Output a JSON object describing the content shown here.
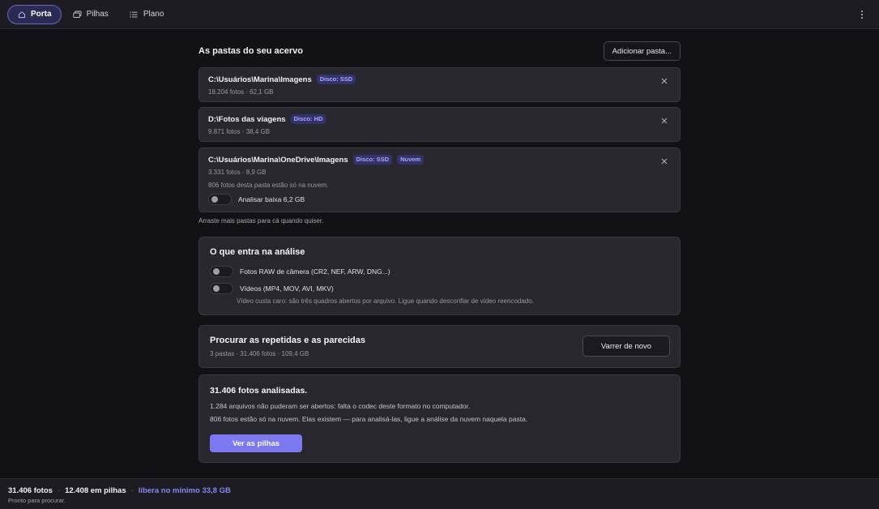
{
  "topbar": {
    "nav": [
      {
        "label": "Porta",
        "icon": "home-icon",
        "active": true
      },
      {
        "label": "Pilhas",
        "icon": "photos-stack-icon",
        "active": false
      },
      {
        "label": "Plano",
        "icon": "list-icon",
        "active": false
      }
    ],
    "menu_icon": "more-vertical-icon"
  },
  "folders_section": {
    "title": "As pastas do seu acervo",
    "add_button": "Adicionar pasta...",
    "folders": [
      {
        "path": "C:\\Usuários\\Marina\\Imagens",
        "badges": [
          "Disco: SSD"
        ],
        "meta": "18.204 fotos · 62,1 GB"
      },
      {
        "path": "D:\\Fotos das viagens",
        "badges": [
          "Disco: HD"
        ],
        "meta": "9.871 fotos · 38,4 GB"
      },
      {
        "path": "C:\\Usuários\\Marina\\OneDrive\\Imagens",
        "badges": [
          "Disco: SSD",
          "Nuvem"
        ],
        "meta": "3.331 fotos · 8,9 GB",
        "note": "806 fotos desta pasta estão só na nuvem.",
        "toggle_label": "Analisar baixa 6,2 GB",
        "toggle_on": false
      }
    ],
    "hint": "Arraste mais pastas para cá quando quiser."
  },
  "analysis": {
    "title": "O que entra na análise",
    "options": [
      {
        "label": "Fotos RAW de câmera (CR2, NEF, ARW, DNG...)",
        "on": false
      },
      {
        "label": "Vídeos (MP4, MOV, AVI, MKV)",
        "on": false
      }
    ],
    "video_note": "Vídeo custa caro: são três quadros abertos por arquivo. Ligue quando desconfiar de vídeo reencodado."
  },
  "search": {
    "title": "Procurar as repetidas e as parecidas",
    "summary": "3 pastas · 31.406 fotos · 109,4 GB",
    "button": "Varrer de novo"
  },
  "result": {
    "title": "31.406 fotos analisadas.",
    "line1": "1.284 arquivos não puderam ser abertos: falta o codec deste formato no computador.",
    "line2": "806 fotos estão só na nuvem. Elas existem — para analisá-las, ligue a análise da nuvem naquela pasta.",
    "button": "Ver as pilhas"
  },
  "statusbar": {
    "photos": "31.406 fotos",
    "stacks": "12.408 em pilhas",
    "frees": "libera no mínimo 33,8 GB",
    "status": "Pronto para procurar."
  },
  "colors": {
    "background": "#121116",
    "card": "#28272d",
    "accent": "#7c79f0",
    "badge_text": "#a9a6ff"
  }
}
